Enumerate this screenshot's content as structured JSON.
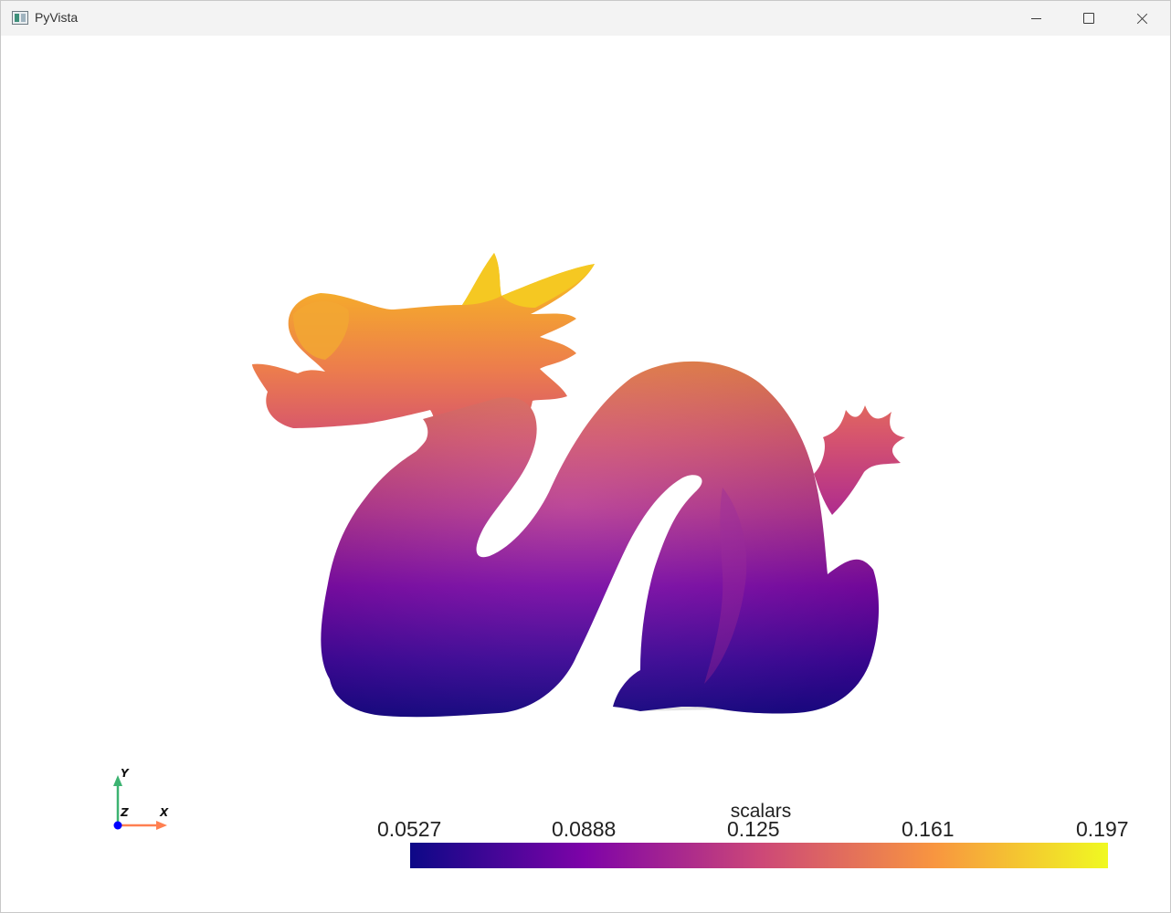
{
  "window": {
    "title": "PyVista"
  },
  "titlebar_buttons": {
    "minimize": "minimize-icon",
    "maximize": "maximize-icon",
    "close": "close-icon"
  },
  "scene": {
    "background": "#ffffff",
    "mesh": "dragon",
    "colormap": "plasma"
  },
  "scalar_bar": {
    "title": "scalars",
    "labels": [
      "0.0527",
      "0.0888",
      "0.125",
      "0.161",
      "0.197"
    ],
    "colors": [
      "#0d0887",
      "#7e03a8",
      "#cc4778",
      "#f89540",
      "#f0f921"
    ]
  },
  "axes_widget": {
    "x_label": "X",
    "y_label": "Y",
    "z_label": "Z",
    "x_color": "#ff7f50",
    "y_color": "#3cb371",
    "z_color": "#0000ff"
  }
}
